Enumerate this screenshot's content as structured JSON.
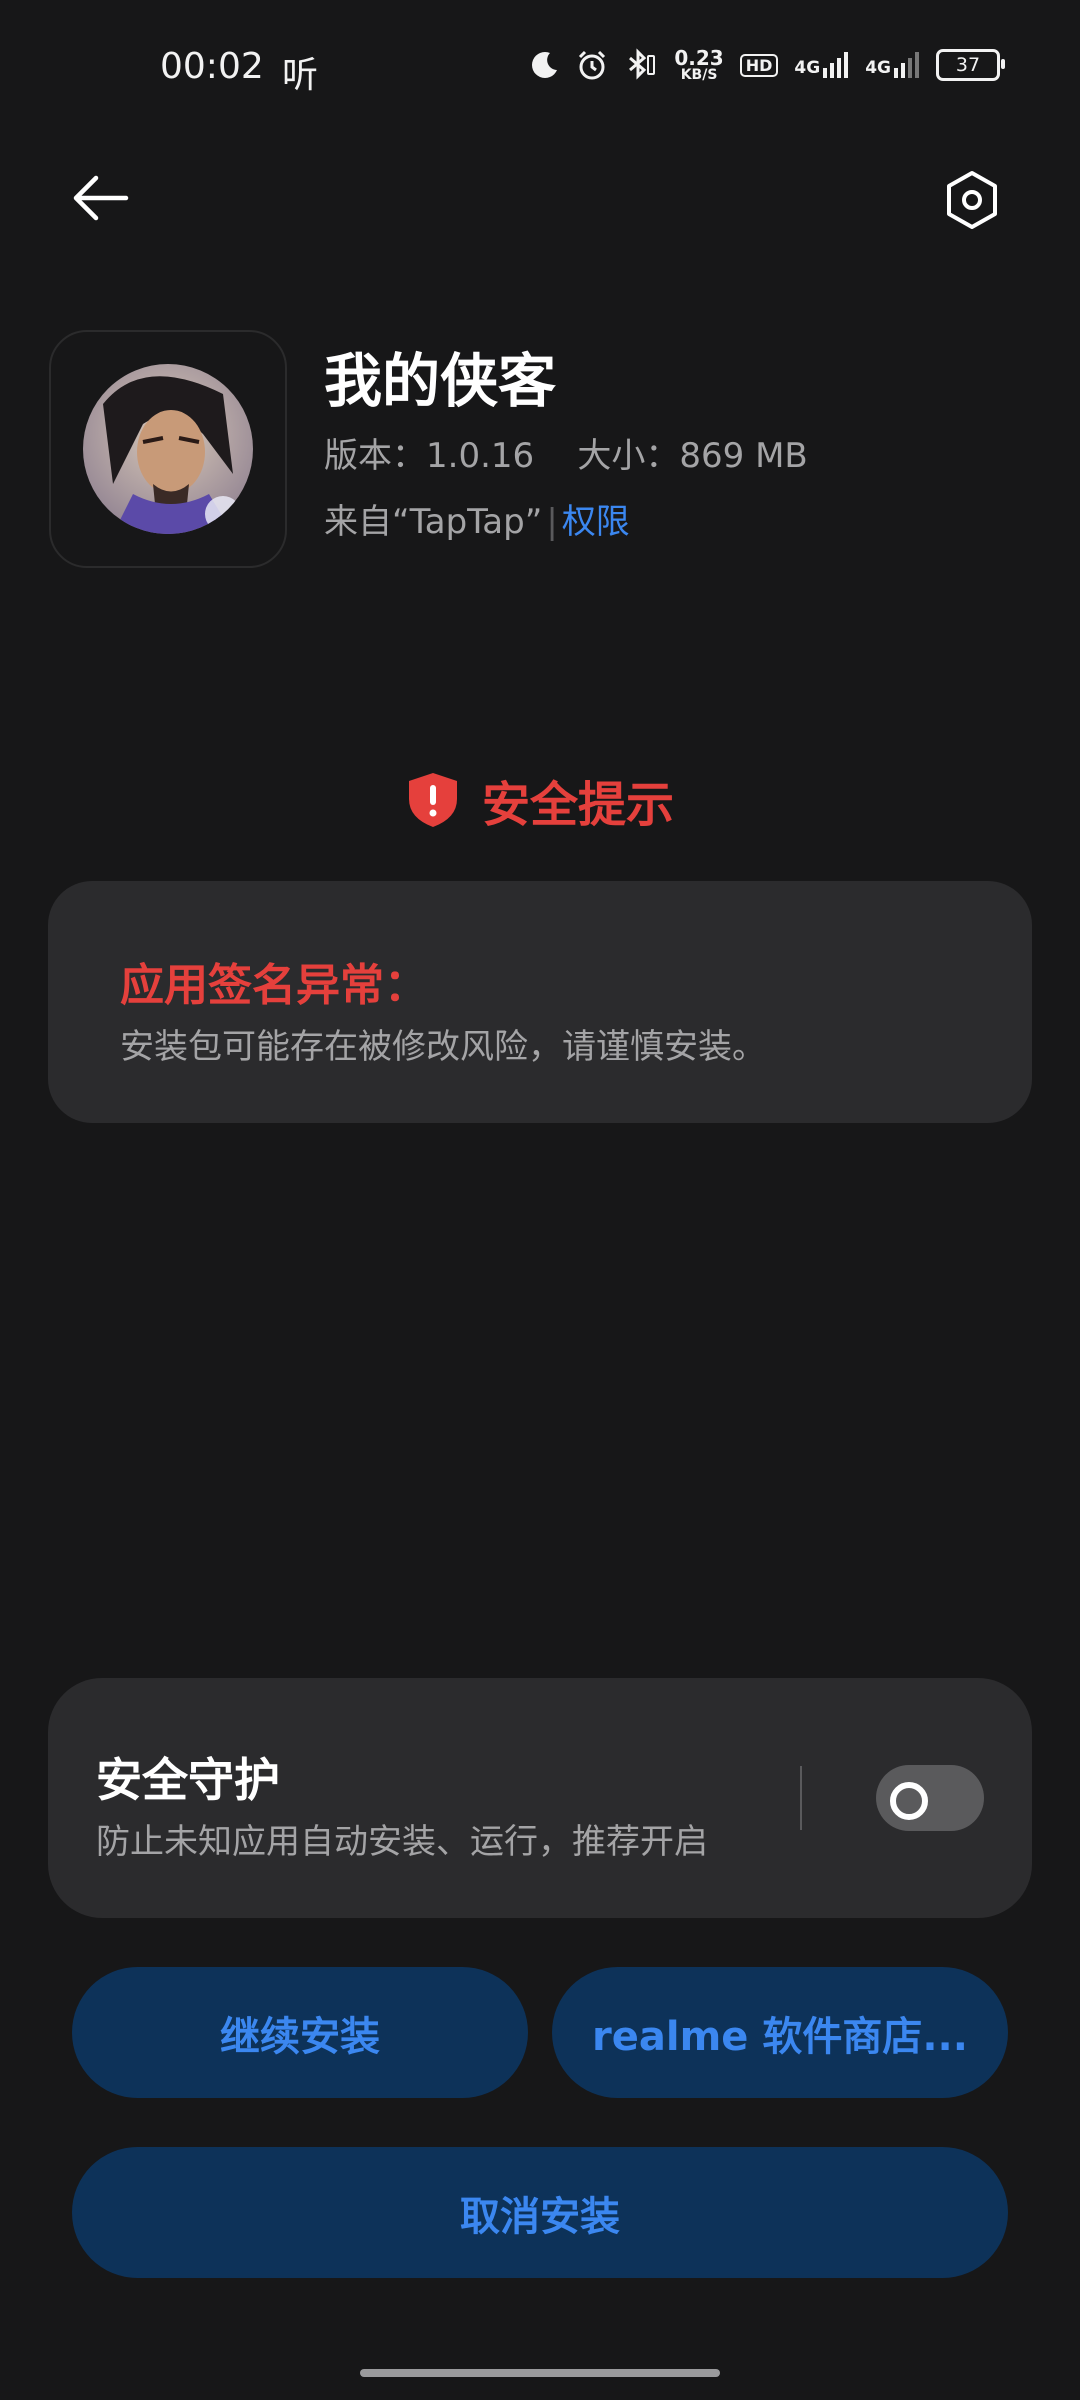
{
  "status_bar": {
    "time": "00:02",
    "extra": "听",
    "net_speed_value": "0.23",
    "net_speed_unit": "KB/S",
    "hd_badge": "HD",
    "signal_1": "4G",
    "signal_2": "4G",
    "battery": "37",
    "icons": [
      "moon-icon",
      "alarm-icon",
      "bluetooth-icon",
      "hd-icon",
      "signal-icon",
      "battery-icon"
    ]
  },
  "nav": {
    "back_icon": "back-arrow-icon",
    "settings_icon": "settings-hexagon-icon"
  },
  "app": {
    "name": "我的侠客",
    "meta": "版本：1.0.16    大小：869 MB",
    "source_prefix": "来自“TapTap”",
    "source_separator": "|",
    "permissions_link": "权限"
  },
  "warning": {
    "title": "安全提示",
    "card_title": "应用签名异常：",
    "card_desc": "安装包可能存在被修改风险，请谨慎安装。",
    "color": "#e5403c"
  },
  "guard": {
    "title": "安全守护",
    "desc": "防止未知应用自动安装、运行，推荐开启",
    "enabled": false
  },
  "buttons": {
    "continue": "继续安装",
    "store": "realme 软件商店...",
    "cancel": "取消安装"
  },
  "colors": {
    "background": "#171718",
    "card": "#2b2b2d",
    "accent": "#3b87f0",
    "button_bg": "#0d3259"
  }
}
